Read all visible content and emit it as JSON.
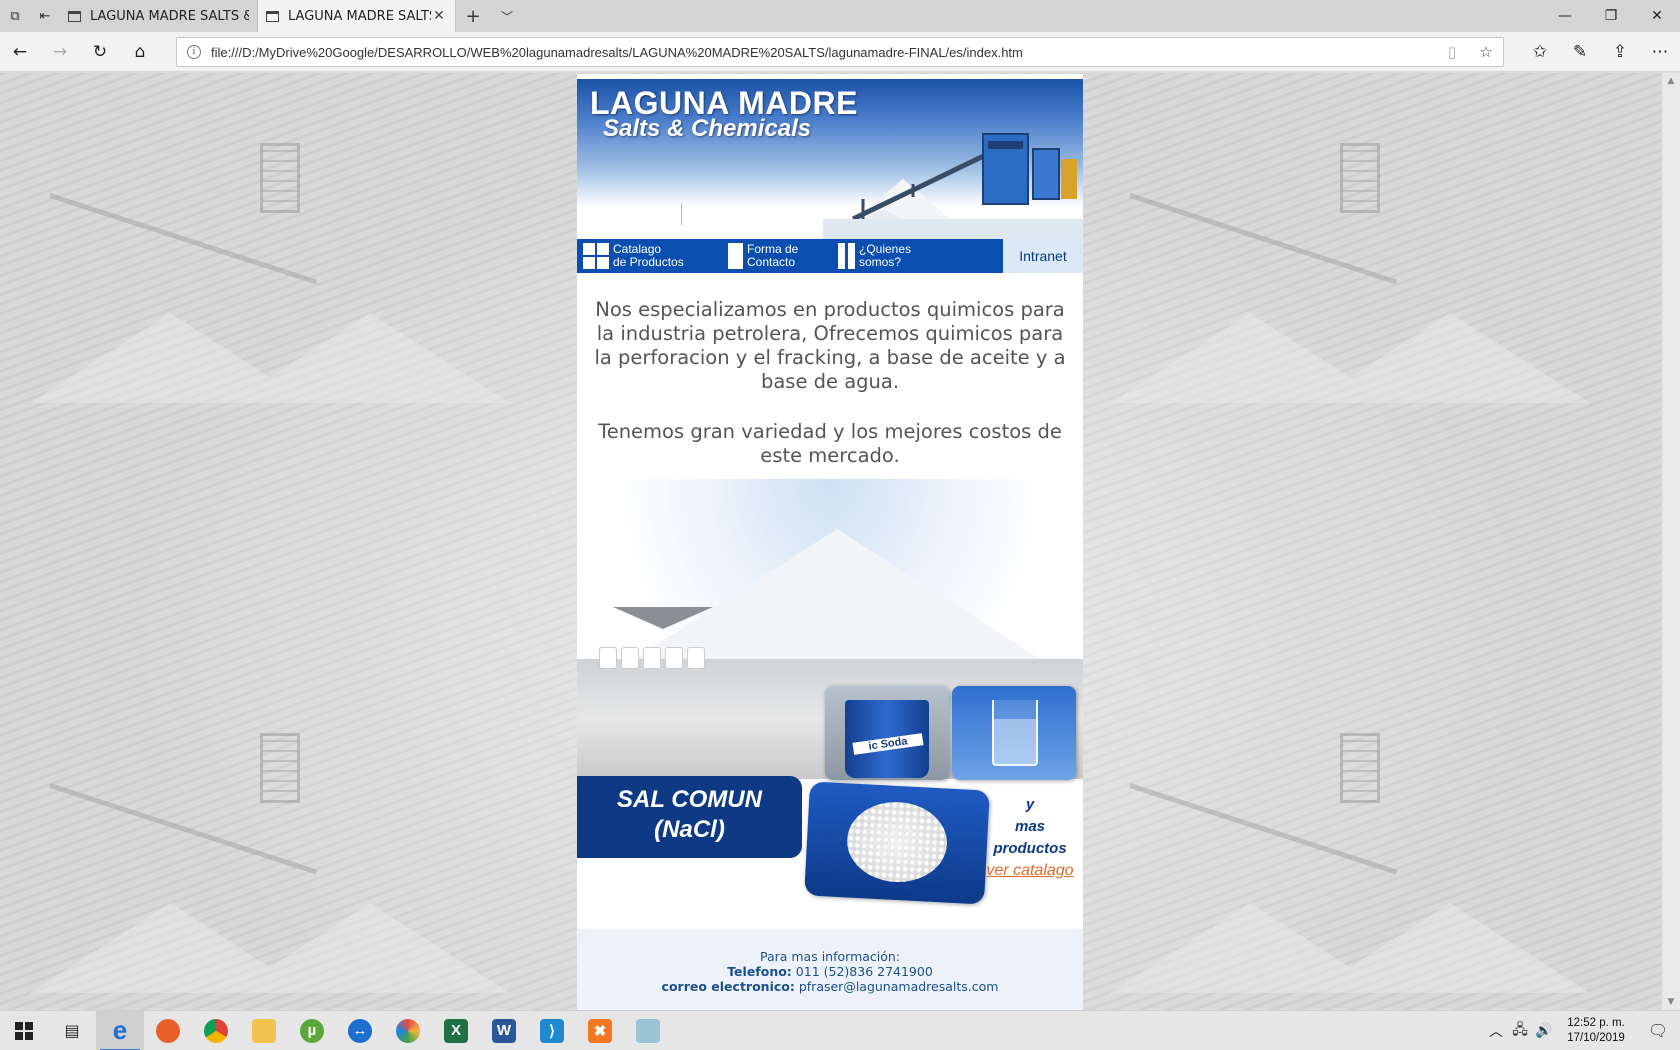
{
  "browser": {
    "tabs": [
      {
        "title": "LAGUNA MADRE SALTS & C",
        "active": false
      },
      {
        "title": "LAGUNA MADRE SALTS",
        "active": true
      }
    ],
    "address": "file:///D:/MyDrive%20Google/DESARROLLO/WEB%20lagunamadresalts/LAGUNA%20MADRE%20SALTS/lagunamadre-FINAL/es/index.htm"
  },
  "site": {
    "brand": "LAGUNA MADRE",
    "brand_sub": "Salts & Chemicals",
    "menu": {
      "catalog_line1": "Catalago",
      "catalog_line2": "de Productos",
      "contact_line1": "Forma de",
      "contact_line2": "Contacto",
      "about_line1": "¿Quienes",
      "about_line2": "somos?",
      "intranet": "Intranet"
    },
    "intro": [
      "Nos especializamos en productos quimicos para la industria petrolera, Ofrecemos quimicos para la perforacion y el fracking, a base de aceite y a base de agua.",
      "Tenemos gran variedad y los mejores costos de este mercado."
    ],
    "products": {
      "sal_line1": "SAL COMUN",
      "sal_line2": "(NaCl)",
      "bucket_label": "ic Soda",
      "more_line1": "y",
      "more_line2": "mas",
      "more_line3": "productos",
      "more_link": "ver catalago"
    },
    "footer": {
      "info": "Para mas información:",
      "phone_label": "Telefono:",
      "phone": "011 (52)836 2741900",
      "email_label": "correo electronico:",
      "email": "pfraser@lagunamadresalts.com"
    }
  },
  "taskbar": {
    "time": "12:52 p. m.",
    "date": "17/10/2019"
  }
}
